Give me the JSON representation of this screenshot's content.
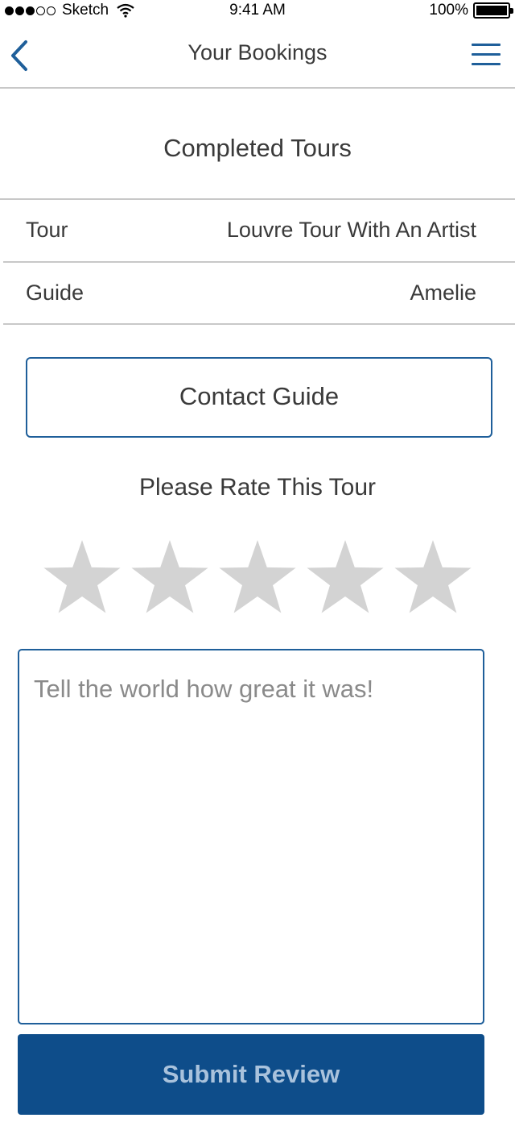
{
  "status_bar": {
    "carrier": "Sketch",
    "time": "9:41 AM",
    "battery": "100%"
  },
  "nav": {
    "title": "Your Bookings",
    "back_icon": "chevron-left-icon",
    "menu_icon": "hamburger-menu-icon",
    "accent_color": "#1f5f9a"
  },
  "section_title": "Completed Tours",
  "details": [
    {
      "label": "Tour",
      "value": "Louvre Tour With An Artist"
    },
    {
      "label": "Guide",
      "value": "Amelie"
    }
  ],
  "contact_button": "Contact Guide",
  "rating": {
    "title": "Please Rate This Tour",
    "max": 5,
    "value": 0,
    "star_color": "#d3d3d3"
  },
  "review": {
    "placeholder": "Tell the world how great it was!",
    "value": ""
  },
  "submit_button": "Submit Review",
  "colors": {
    "primary": "#0e4d8a",
    "border": "#1f5f9a",
    "divider": "#c8c8c8"
  }
}
